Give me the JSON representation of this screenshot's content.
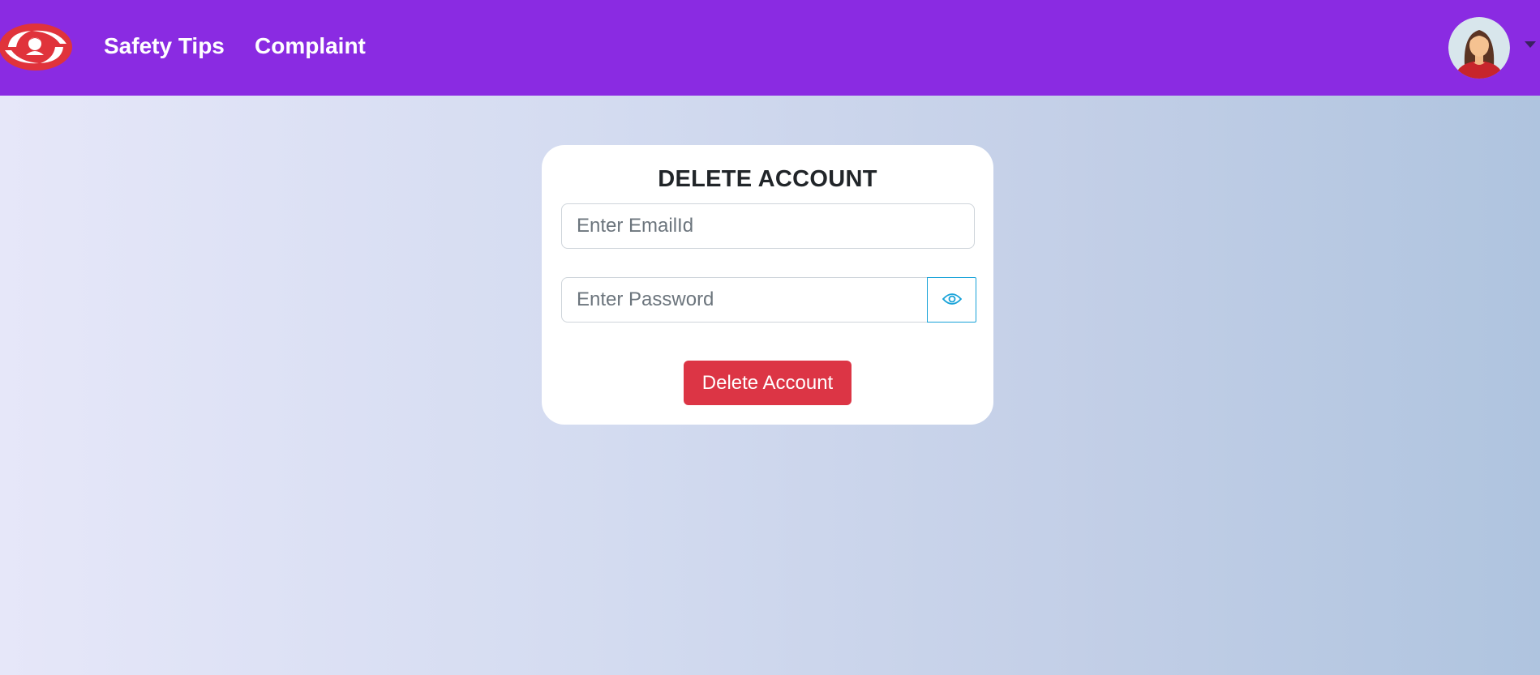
{
  "navbar": {
    "logo_icon": "hands-protecting-woman-logo",
    "links": [
      {
        "label": "Safety Tips"
      },
      {
        "label": "Complaint"
      }
    ],
    "avatar_icon": "woman-avatar",
    "profile_menu_icon": "caret-down-icon"
  },
  "delete_form": {
    "title": "DELETE ACCOUNT",
    "email_placeholder": "Enter EmailId",
    "email_value": "",
    "password_placeholder": "Enter Password",
    "password_value": "",
    "toggle_icon": "eye-icon",
    "submit_label": "Delete Account"
  },
  "colors": {
    "navbar": "#8a2be2",
    "danger": "#dc3545",
    "info": "#17a2d8",
    "logo": "#e0333b"
  }
}
